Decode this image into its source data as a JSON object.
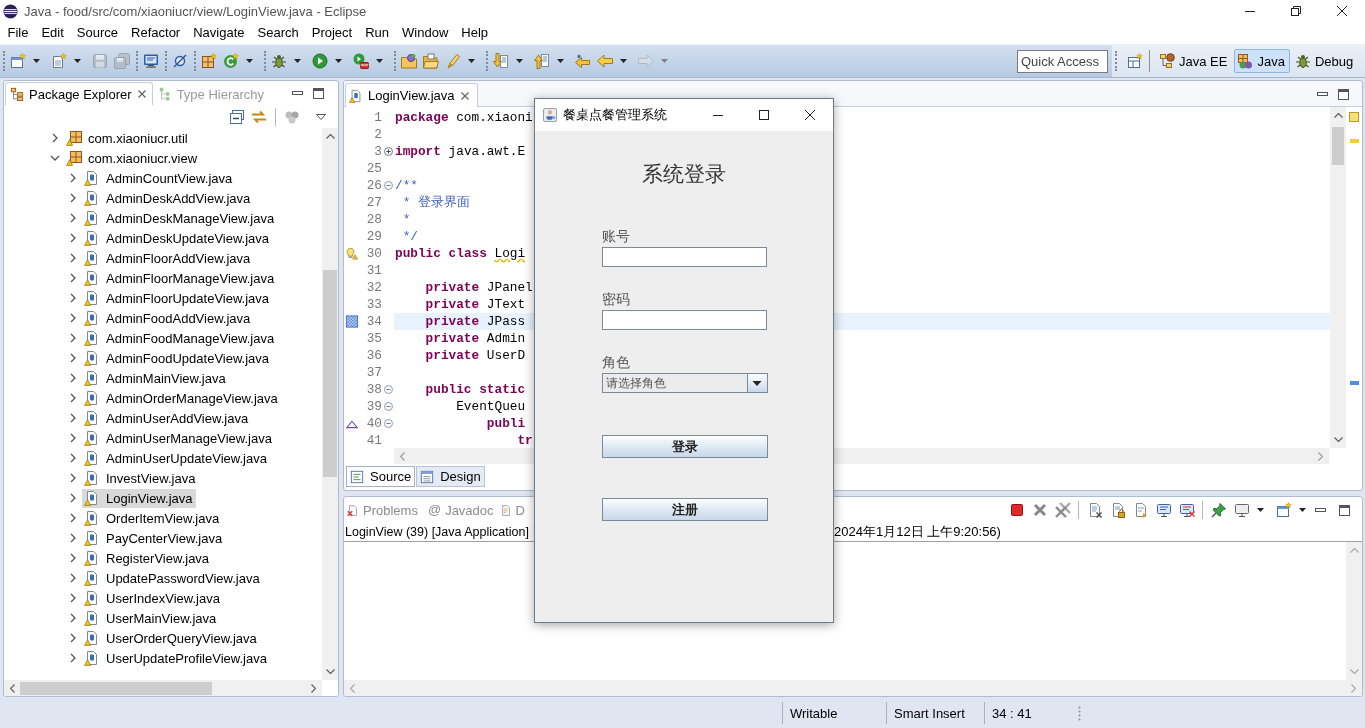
{
  "window": {
    "title": "Java - food/src/com/xiaoniucr/view/LoginView.java - Eclipse"
  },
  "menu": [
    "File",
    "Edit",
    "Source",
    "Refactor",
    "Navigate",
    "Search",
    "Project",
    "Run",
    "Window",
    "Help"
  ],
  "toolbar": [
    [
      {
        "kind": "new",
        "dropdown": true,
        "disabled": false
      },
      {
        "kind": "newitem",
        "dropdown": true,
        "disabled": false
      },
      {
        "kind": "save",
        "dropdown": false,
        "disabled": true
      },
      {
        "kind": "saveall",
        "dropdown": false,
        "disabled": true
      }
    ],
    [
      {
        "kind": "monitor",
        "dropdown": false,
        "disabled": false
      }
    ],
    [
      {
        "kind": "skip",
        "dropdown": false,
        "disabled": false
      }
    ],
    [
      {
        "kind": "newclass",
        "dropdown": false,
        "disabled": false
      },
      {
        "kind": "refresh",
        "dropdown": true,
        "disabled": false
      }
    ],
    [
      {
        "kind": "debug",
        "dropdown": true,
        "disabled": false
      },
      {
        "kind": "run",
        "dropdown": true,
        "disabled": false
      },
      {
        "kind": "tools",
        "dropdown": true,
        "disabled": false
      }
    ],
    [
      {
        "kind": "opentype",
        "dropdown": false,
        "disabled": false
      },
      {
        "kind": "opentask",
        "dropdown": false,
        "disabled": false
      },
      {
        "kind": "search",
        "dropdown": true,
        "disabled": false
      }
    ],
    [
      {
        "kind": "next",
        "dropdown": true,
        "disabled": false
      },
      {
        "kind": "prev",
        "dropdown": true,
        "disabled": false
      },
      {
        "kind": "lastedit",
        "dropdown": false,
        "disabled": false
      },
      {
        "kind": "back",
        "dropdown": true,
        "disabled": false
      },
      {
        "kind": "forward",
        "dropdown": true,
        "disabled": true
      }
    ]
  ],
  "quick_access": {
    "placeholder": "Quick Access"
  },
  "perspectives": [
    {
      "label": "Java EE",
      "kind": "javaee",
      "selected": false
    },
    {
      "label": "Java",
      "kind": "java",
      "selected": true
    },
    {
      "label": "Debug",
      "kind": "debug",
      "selected": false
    }
  ],
  "package_explorer": {
    "tabs": [
      {
        "label": "Package Explorer",
        "kind": "packages",
        "selected": true
      },
      {
        "label": "Type Hierarchy",
        "kind": "hierarchy",
        "selected": false
      }
    ],
    "tree": [
      {
        "label": "com.xiaoniucr.util",
        "kind": "package",
        "expanded": false,
        "selected": false
      },
      {
        "label": "com.xiaoniucr.view",
        "kind": "package",
        "expanded": true,
        "selected": false,
        "children": [
          {
            "label": "AdminCountView.java",
            "kind": "file",
            "expanded": false,
            "selected": false
          },
          {
            "label": "AdminDeskAddView.java",
            "kind": "file",
            "expanded": false,
            "selected": false
          },
          {
            "label": "AdminDeskManageView.java",
            "kind": "file",
            "expanded": false,
            "selected": false
          },
          {
            "label": "AdminDeskUpdateView.java",
            "kind": "file",
            "expanded": false,
            "selected": false
          },
          {
            "label": "AdminFloorAddView.java",
            "kind": "file",
            "expanded": false,
            "selected": false
          },
          {
            "label": "AdminFloorManageView.java",
            "kind": "file",
            "expanded": false,
            "selected": false
          },
          {
            "label": "AdminFloorUpdateView.java",
            "kind": "file",
            "expanded": false,
            "selected": false
          },
          {
            "label": "AdminFoodAddView.java",
            "kind": "file",
            "expanded": false,
            "selected": false
          },
          {
            "label": "AdminFoodManageView.java",
            "kind": "file",
            "expanded": false,
            "selected": false
          },
          {
            "label": "AdminFoodUpdateView.java",
            "kind": "file",
            "expanded": false,
            "selected": false
          },
          {
            "label": "AdminMainView.java",
            "kind": "file",
            "expanded": false,
            "selected": false
          },
          {
            "label": "AdminOrderManageView.java",
            "kind": "file",
            "expanded": false,
            "selected": false
          },
          {
            "label": "AdminUserAddView.java",
            "kind": "file",
            "expanded": false,
            "selected": false
          },
          {
            "label": "AdminUserManageView.java",
            "kind": "file",
            "expanded": false,
            "selected": false
          },
          {
            "label": "AdminUserUpdateView.java",
            "kind": "file",
            "expanded": false,
            "selected": false
          },
          {
            "label": "InvestView.java",
            "kind": "file",
            "expanded": false,
            "selected": false
          },
          {
            "label": "LoginView.java",
            "kind": "file",
            "expanded": false,
            "selected": true
          },
          {
            "label": "OrderItemView.java",
            "kind": "file",
            "expanded": false,
            "selected": false
          },
          {
            "label": "PayCenterView.java",
            "kind": "file",
            "expanded": false,
            "selected": false
          },
          {
            "label": "RegisterView.java",
            "kind": "file",
            "expanded": false,
            "selected": false
          },
          {
            "label": "UpdatePasswordView.java",
            "kind": "file",
            "expanded": false,
            "selected": false
          },
          {
            "label": "UserIndexView.java",
            "kind": "file",
            "expanded": false,
            "selected": false
          },
          {
            "label": "UserMainView.java",
            "kind": "file",
            "expanded": false,
            "selected": false
          },
          {
            "label": "UserOrderQueryView.java",
            "kind": "file",
            "expanded": false,
            "selected": false
          },
          {
            "label": "UserUpdateProfileView.java",
            "kind": "file",
            "expanded": false,
            "selected": false
          }
        ]
      }
    ]
  },
  "editor": {
    "tabs": [
      {
        "label": "LoginView.java",
        "selected": true
      }
    ],
    "lines": [
      {
        "number": "1",
        "current": false,
        "segments": [
          {
            "kind": "keyword",
            "text": "package"
          },
          {
            "kind": "plain",
            "text": " com.xiaoni"
          }
        ]
      },
      {
        "number": "2",
        "current": false
      },
      {
        "number": "3",
        "current": false,
        "fold": {
          "collapsed": true
        },
        "segments": [
          {
            "kind": "keyword",
            "text": "import"
          },
          {
            "kind": "plain",
            "text": " java.awt.E"
          }
        ]
      },
      {
        "number": "25",
        "current": false
      },
      {
        "number": "26",
        "current": false,
        "fold": {
          "collapsed": false
        },
        "segments": [
          {
            "kind": "comment",
            "text": "/**"
          }
        ]
      },
      {
        "number": "27",
        "current": false,
        "segments": [
          {
            "kind": "comment",
            "text": " * 登录界面"
          }
        ]
      },
      {
        "number": "28",
        "current": false,
        "segments": [
          {
            "kind": "comment",
            "text": " *"
          }
        ]
      },
      {
        "number": "29",
        "current": false,
        "segments": [
          {
            "kind": "comment",
            "text": " */"
          }
        ]
      },
      {
        "number": "30",
        "current": false,
        "marker": {
          "kind": "warning"
        },
        "segments": [
          {
            "kind": "keyword",
            "text": "public"
          },
          {
            "kind": "keyword",
            "text": " class"
          },
          {
            "kind": "warning",
            "text": " Logi"
          }
        ]
      },
      {
        "number": "31",
        "current": false
      },
      {
        "number": "32",
        "current": false,
        "segments": [
          {
            "kind": "keyword",
            "text": "    private"
          },
          {
            "kind": "plain",
            "text": " JPanel"
          }
        ]
      },
      {
        "number": "33",
        "current": false,
        "segments": [
          {
            "kind": "keyword",
            "text": "    private"
          },
          {
            "kind": "plain",
            "text": " JText"
          }
        ]
      },
      {
        "number": "34",
        "current": true,
        "marker": {
          "kind": "occurrence"
        },
        "segments": [
          {
            "kind": "keyword",
            "text": "    private"
          },
          {
            "kind": "plain",
            "text": " JPass"
          }
        ]
      },
      {
        "number": "35",
        "current": false,
        "segments": [
          {
            "kind": "keyword",
            "text": "    private"
          },
          {
            "kind": "plain",
            "text": " Admin"
          }
        ]
      },
      {
        "number": "36",
        "current": false,
        "segments": [
          {
            "kind": "keyword",
            "text": "    private"
          },
          {
            "kind": "plain",
            "text": " UserD"
          }
        ]
      },
      {
        "number": "37",
        "current": false
      },
      {
        "number": "38",
        "current": false,
        "fold": {
          "collapsed": false
        },
        "segments": [
          {
            "kind": "keyword",
            "text": "    public"
          },
          {
            "kind": "keyword",
            "text": " static"
          }
        ]
      },
      {
        "number": "39",
        "current": false,
        "fold": {
          "collapsed": false
        },
        "segments": [
          {
            "kind": "plain",
            "text": "        EventQueu"
          }
        ]
      },
      {
        "number": "40",
        "current": false,
        "fold": {
          "collapsed": false
        },
        "marker": {
          "kind": "override"
        },
        "segments": [
          {
            "kind": "keyword",
            "text": "            publi"
          }
        ]
      },
      {
        "number": "41",
        "current": false,
        "segments": [
          {
            "kind": "keyword",
            "text": "                tr"
          }
        ]
      }
    ],
    "bottom_tabs": [
      {
        "label": "Source",
        "kind": "source",
        "selected": true
      },
      {
        "label": "Design",
        "kind": "design",
        "selected": false
      }
    ]
  },
  "console": {
    "tabs": [
      {
        "label": "Problems",
        "kind": "problems",
        "selected": false
      },
      {
        "label": "Javadoc",
        "kind": "javadoc",
        "glyph": "@",
        "selected": false
      },
      {
        "label": "D",
        "kind": "declaration",
        "selected": false
      }
    ],
    "toolbar": [
      [
        {
          "kind": "stop",
          "dropdown": false
        },
        {
          "kind": "remove",
          "dropdown": false
        },
        {
          "kind": "removeall",
          "dropdown": false
        }
      ],
      [
        {
          "kind": "clear",
          "dropdown": false
        },
        {
          "kind": "lock",
          "dropdown": false
        },
        {
          "kind": "wrap",
          "dropdown": false
        },
        {
          "kind": "stdout",
          "dropdown": false
        },
        {
          "kind": "stderr",
          "dropdown": false
        }
      ],
      [
        {
          "kind": "pin",
          "dropdown": false
        },
        {
          "kind": "display",
          "dropdown": true
        },
        {
          "kind": "open",
          "dropdown": true
        }
      ]
    ],
    "process": "LoginView (39) [Java Application]",
    "launch_time": "2024年1月12日 上午9:20:56)"
  },
  "status_bar": [
    "Writable",
    "Smart Insert",
    "34 : 41"
  ],
  "dialog": {
    "title": "餐桌点餐管理系统",
    "heading": "系统登录",
    "fields": [
      {
        "label": "账号",
        "kind": "input"
      },
      {
        "label": "密码",
        "kind": "input"
      },
      {
        "label": "角色",
        "kind": "select",
        "value": "请选择角色"
      }
    ],
    "buttons": [
      "登录",
      "注册"
    ]
  }
}
